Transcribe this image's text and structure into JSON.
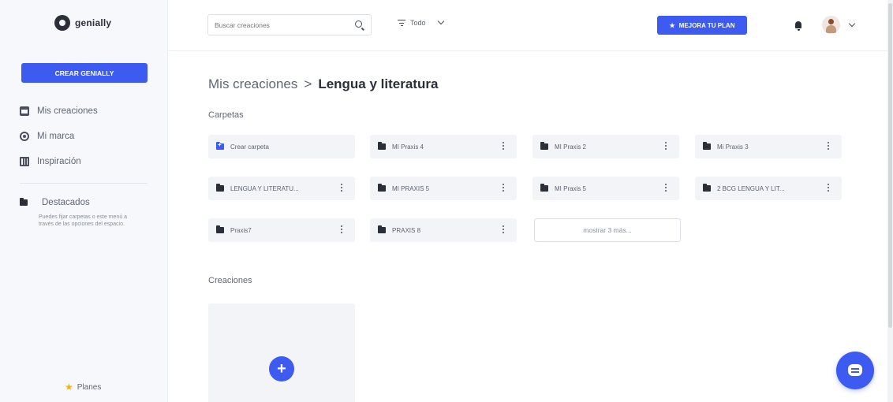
{
  "brand": {
    "name": "genially",
    "accent": "#3d5af1"
  },
  "sidebar": {
    "create_label": "CREAR GENIALLY",
    "items": [
      {
        "label": "Mis creaciones",
        "icon": "creations-icon"
      },
      {
        "label": "Mi marca",
        "icon": "brand-icon"
      },
      {
        "label": "Inspiración",
        "icon": "inspiration-icon"
      }
    ],
    "featured": {
      "title": "Destacados",
      "description": "Puedes fijar carpetas o este menú a través de las opciones del espacio."
    },
    "plans_label": "Planes"
  },
  "header": {
    "search_placeholder": "Buscar creaciones",
    "filter_label": "Todo",
    "upgrade_label": "MEJORA TU PLAN"
  },
  "main": {
    "breadcrumb_parent": "Mis creaciones",
    "breadcrumb_separator": ">",
    "breadcrumb_current": "Lengua y literatura",
    "folders_heading": "Carpetas",
    "new_folder_label": "Crear carpeta",
    "folders": [
      {
        "name": "MI Praxis 4"
      },
      {
        "name": "MI Praxis 2"
      },
      {
        "name": "Mi Praxis 3"
      },
      {
        "name": "LENGUA Y LITERATU..."
      },
      {
        "name": "MI PRAXIS 5"
      },
      {
        "name": "MI Praxis 5"
      },
      {
        "name": "2 BCG LENGUA Y LIT..."
      },
      {
        "name": "Praxis7"
      },
      {
        "name": "PRAXIS 8"
      }
    ],
    "show_more_label": "mostrar 3 más...",
    "creations_heading": "Creaciones",
    "new_creation_icon": "+"
  }
}
